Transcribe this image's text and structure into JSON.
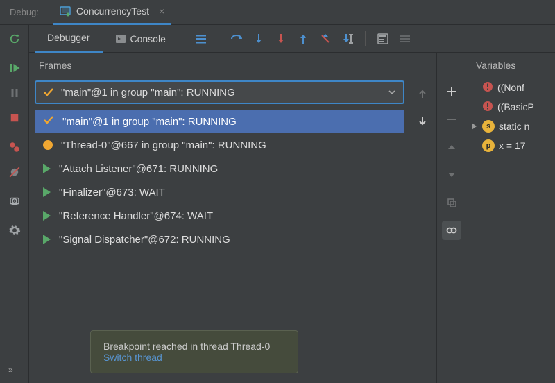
{
  "debug_label": "Debug:",
  "run_config_name": "ConcurrencyTest",
  "tabs": {
    "debugger": "Debugger",
    "console": "Console"
  },
  "frames": {
    "title": "Frames",
    "combo_selected": "\"main\"@1 in group \"main\": RUNNING",
    "threads": [
      {
        "icon": "check",
        "label": "\"main\"@1 in group \"main\": RUNNING",
        "selected": true
      },
      {
        "icon": "dot",
        "label": "\"Thread-0\"@667 in group \"main\": RUNNING"
      },
      {
        "icon": "play",
        "label": "\"Attach Listener\"@671: RUNNING"
      },
      {
        "icon": "play",
        "label": "\"Finalizer\"@673: WAIT"
      },
      {
        "icon": "play",
        "label": "\"Reference Handler\"@674: WAIT"
      },
      {
        "icon": "play",
        "label": "\"Signal Dispatcher\"@672: RUNNING"
      }
    ]
  },
  "variables": {
    "title": "Variables",
    "nodes": [
      {
        "kind": "error",
        "text": "((Nonf"
      },
      {
        "kind": "error",
        "text": "((BasicP"
      },
      {
        "kind": "static",
        "badge": "s",
        "color": "#e8b33b",
        "text": "static n",
        "expandable": true
      },
      {
        "kind": "prim",
        "badge": "p",
        "color": "#e8b33b",
        "text": "x = 17"
      }
    ]
  },
  "toast": {
    "msg": "Breakpoint reached in thread Thread-0",
    "link": "Switch thread"
  }
}
